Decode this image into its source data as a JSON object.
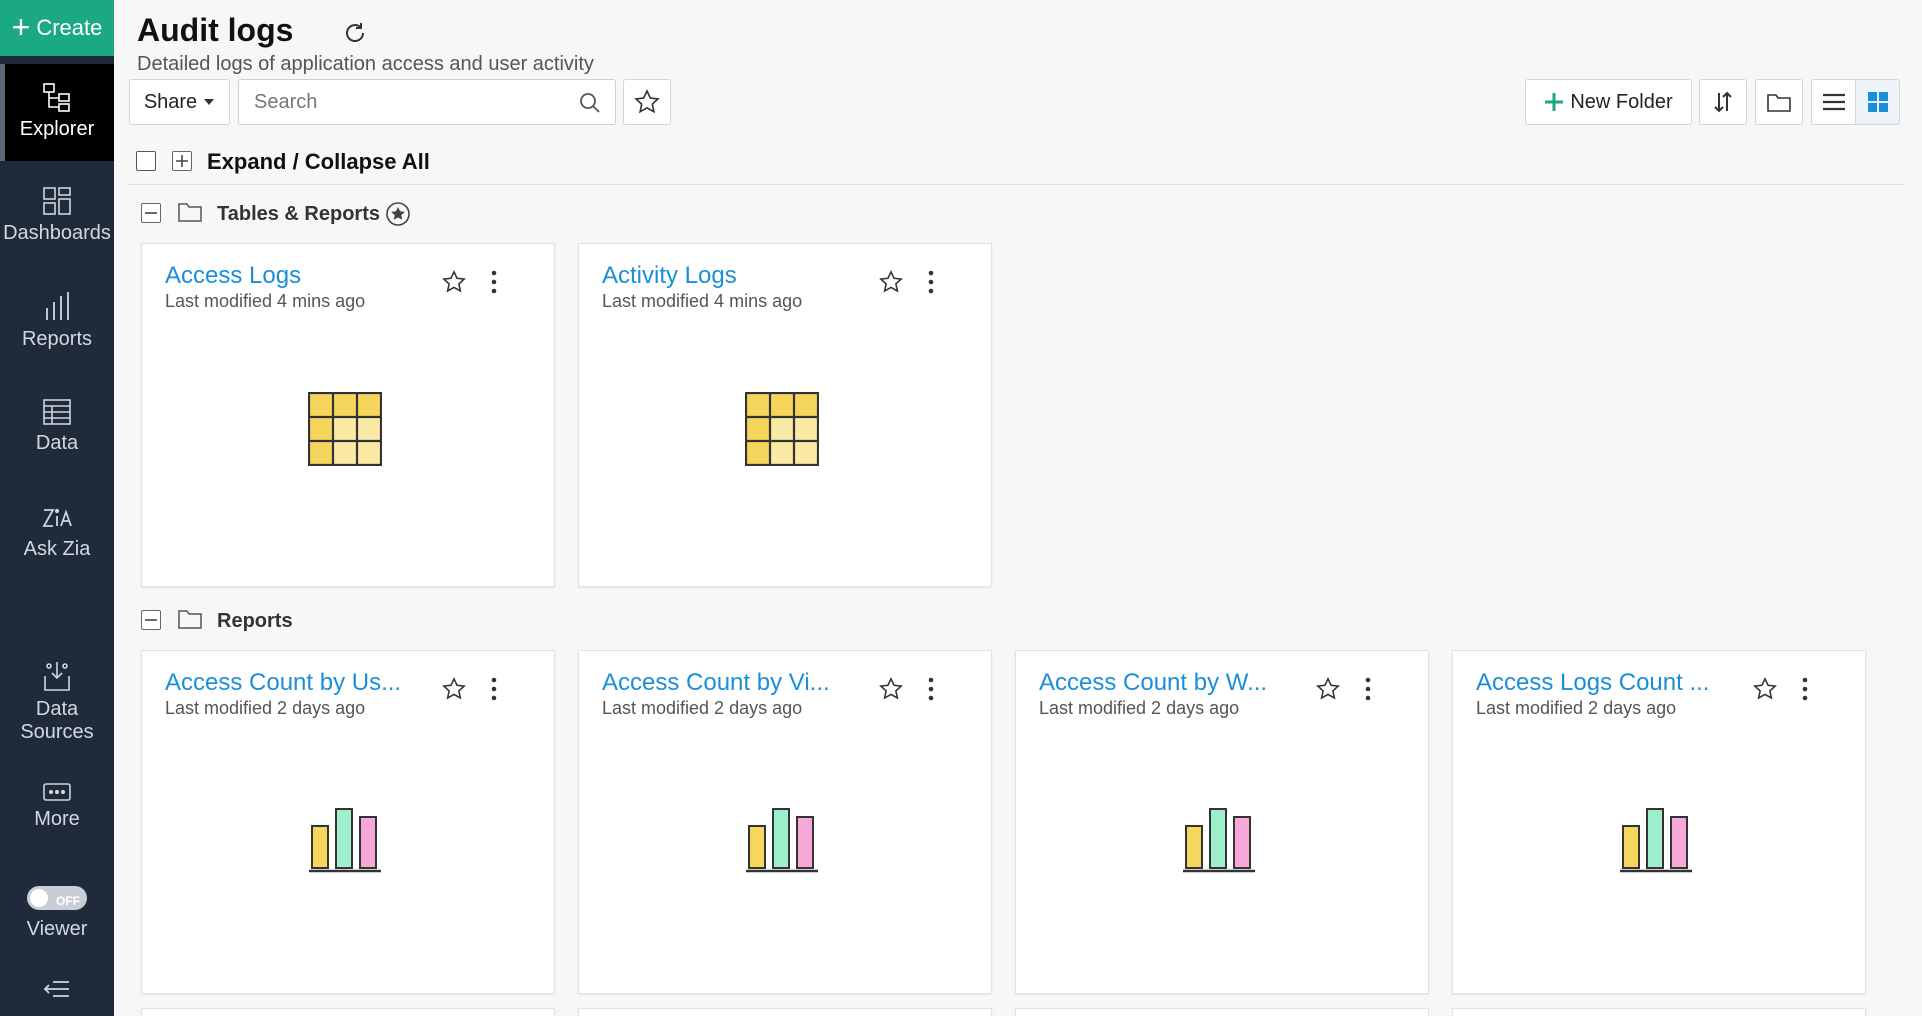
{
  "sidebar": {
    "create_label": "Create",
    "items": [
      {
        "label": "Explorer",
        "icon": "explorer-tree-icon"
      },
      {
        "label": "Dashboards",
        "icon": "dashboard-icon"
      },
      {
        "label": "Reports",
        "icon": "reports-icon"
      },
      {
        "label": "Data",
        "icon": "table-icon"
      },
      {
        "label": "Ask Zia",
        "icon": "zia-icon"
      },
      {
        "label": "Data Sources",
        "icon": "data-sources-icon"
      },
      {
        "label": "More",
        "icon": "more-icon"
      },
      {
        "label": "Viewer",
        "icon": "viewer-toggle"
      }
    ],
    "viewer_toggle_text": "OFF"
  },
  "header": {
    "title": "Audit logs",
    "subtitle": "Detailed logs of application access and user activity"
  },
  "toolbar": {
    "share_label": "Share",
    "search_placeholder": "Search",
    "new_folder_label": "New Folder"
  },
  "expand_label": "Expand / Collapse All",
  "groups": [
    {
      "title": "Tables & Reports",
      "cards": [
        {
          "name": "Access Logs",
          "meta": "Last modified 4 mins ago",
          "kind": "table"
        },
        {
          "name": "Activity Logs",
          "meta": "Last modified 4 mins ago",
          "kind": "table"
        }
      ]
    },
    {
      "title": "Reports",
      "cards": [
        {
          "name": "Access Count by Us...",
          "meta": "Last modified 2 days ago",
          "kind": "chart"
        },
        {
          "name": "Access Count by Vi...",
          "meta": "Last modified 2 days ago",
          "kind": "chart"
        },
        {
          "name": "Access Count by W...",
          "meta": "Last modified 2 days ago",
          "kind": "chart"
        },
        {
          "name": "Access Logs Count ...",
          "meta": "Last modified 2 days ago",
          "kind": "chart"
        }
      ]
    }
  ],
  "colors": {
    "accent_green": "#1aa982",
    "link_blue": "#1a8fd8",
    "sidebar_bg": "#1f2a3a",
    "table_yellow": "#f6d55c",
    "table_light": "#fbe9a6",
    "bar_yellow": "#f7d65e",
    "bar_green": "#9ef0cc",
    "bar_pink": "#f8a8d8"
  }
}
